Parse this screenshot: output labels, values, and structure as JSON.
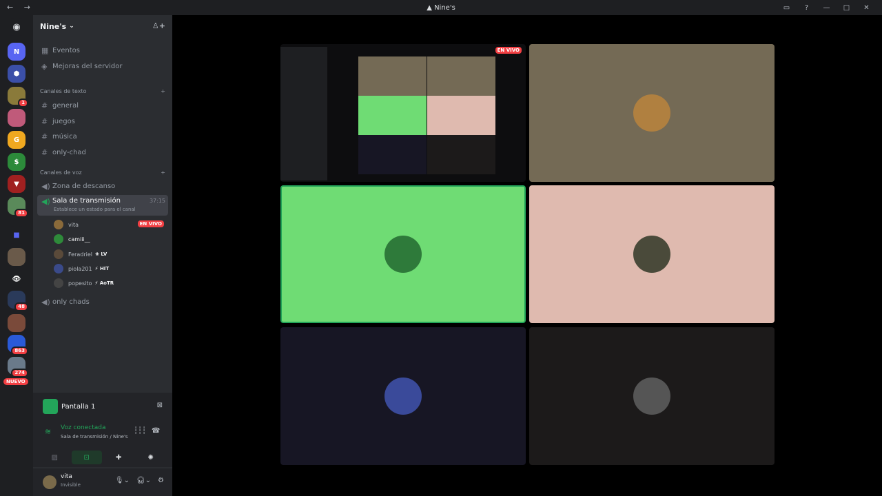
{
  "titlebar": {
    "title": "Nine's"
  },
  "server": {
    "name": "Nine's"
  },
  "top_items": [
    {
      "label": "Eventos"
    },
    {
      "label": "Mejoras del servidor"
    }
  ],
  "text_category": "Canales de texto",
  "text_channels": [
    "general",
    "juegos",
    "música",
    "only-chad"
  ],
  "voice_category": "Canales de voz",
  "voice_channels": {
    "first": "Zona de descanso",
    "active": {
      "name": "Sala de transmisión",
      "time": "37:15",
      "status": "Establece un estado para el canal"
    },
    "last": "only chads"
  },
  "voice_users": [
    {
      "name": "vita",
      "tag": "",
      "live": "EN VIVO"
    },
    {
      "name": "camiii__",
      "tag": ""
    },
    {
      "name": "Feradriel",
      "tag": "LV"
    },
    {
      "name": "piola201",
      "tag": "HIT"
    },
    {
      "name": "popesito",
      "tag": "AoTR"
    }
  ],
  "guild_badges": [
    "1",
    "81",
    "48",
    "863",
    "274"
  ],
  "nuevo": "NUEVO",
  "stream_panel": {
    "title": "Pantalla 1"
  },
  "voice_connection": {
    "status": "Voz conectada",
    "location": "Sala de transmisión / Nine's"
  },
  "user": {
    "name": "vita",
    "status": "Invisible"
  },
  "stage": {
    "live_badge": "EN VIVO"
  },
  "colors": {
    "green_tile": "#6fdc74",
    "pink_tile": "#dfbaaf",
    "brown_tile": "#746a55",
    "navy_tile": "#171624",
    "dark_tile": "#1c1a1a",
    "accent": "#23a55a",
    "danger": "#f23f43"
  }
}
